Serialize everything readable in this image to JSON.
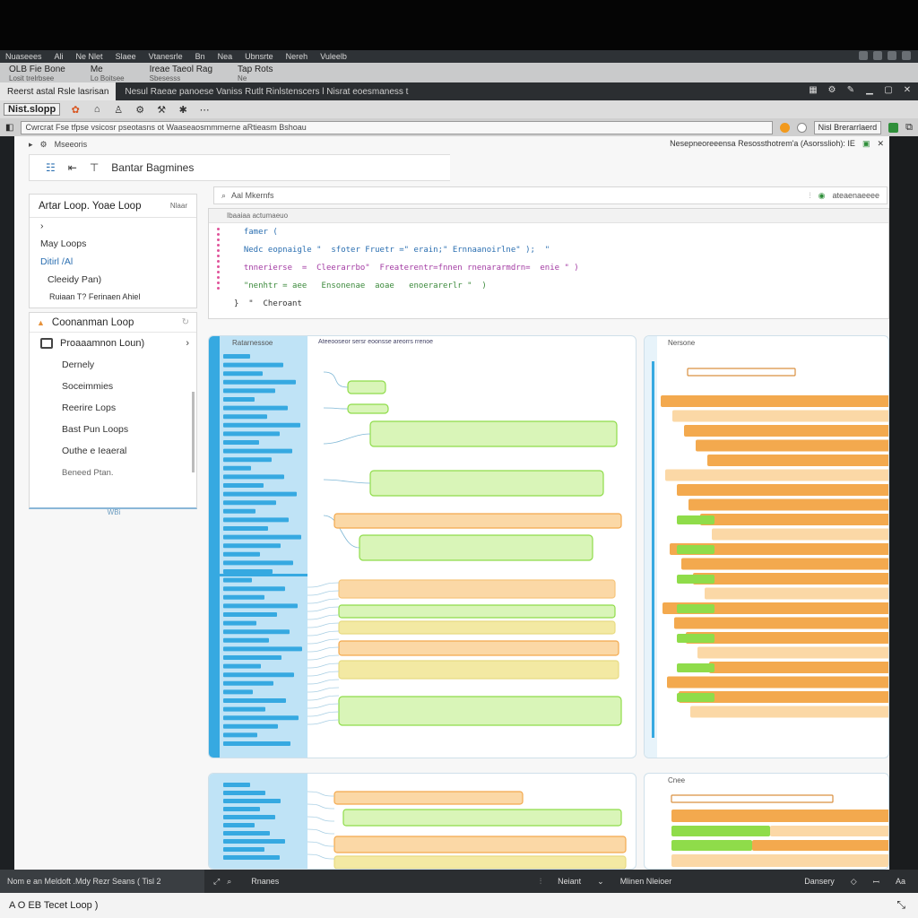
{
  "menubar": {
    "items": [
      "Nuaseees",
      "Ali",
      "Ne Nlet",
      "Slaee",
      "Vtanesrle",
      "Bn",
      "Nea",
      "Ubnsrte",
      "Nereh",
      "Vuleelb"
    ]
  },
  "menurow": {
    "items": [
      {
        "label": "OLB Fie Bone",
        "sub": "Losit trelrbsee"
      },
      {
        "label": "Me",
        "sub": "Lo Boitsee"
      },
      {
        "label": "Ireae Taeol Rag",
        "sub": "Sbesesss"
      },
      {
        "label": "Tap Rots",
        "sub": "Ne"
      }
    ]
  },
  "titlebar": {
    "tab": "Reerst astal Rsle lasrisan",
    "rest": "Nesul Raeae panoese Vaniss Rutlt Rinlstenscers l Nisrat eoesmaness t"
  },
  "toolbar": {
    "brand": "Nist.slopp"
  },
  "addrbar": {
    "url": "Cwrcrat Fse tfpse vsicosr  pseotasns ot Waaseaosmmmerne aRtieasm  Bshoau",
    "chip": "Nisl Brerarrlaerd"
  },
  "pathrow": {
    "left": "Mseeoris",
    "right": "Nesepneoreeensa Resossthotrem'a (Asorsslioh): IE"
  },
  "titlecard": {
    "label": "Bantar Bagmines"
  },
  "sidebar1": {
    "title": "Artar Loop. Yoae Loop",
    "badge": "Nlaar",
    "lines": [
      "›",
      "May Loops",
      "Ditirl /Al",
      "Cleeidy Pan)",
      "Ruiaan T? Ferinaen Ahiel"
    ]
  },
  "sidebar2": {
    "title": "Coonanman Loop",
    "folder": "Proaaamnon Loun)",
    "items": [
      "Dernely",
      "Soceimmies",
      "Reerire Lops",
      "Bast Pun Loops",
      "Outhe e Ieaeral",
      "Beneed Ptan."
    ],
    "footer": "WBi"
  },
  "search": {
    "placeholder": "Aal Mkernfs",
    "right": "ateaenaeeee"
  },
  "codecard": {
    "caption": "Ibaaiaa actumaeuo",
    "lines": [
      "  famer (",
      "  Nedc eopnaigle \"  sfoter Fruetr =\" erain;\" Ernnaanoirlne\" );  \"",
      "  tnnerierse  =  Cleerarrbo\"  Freaterentr=fnnen rnenararmdrn=  enie \" )",
      "  \"nenhtr = aee   Ensonenae  aoae   enoerarerlr \"  )",
      "}  \"  Cheroant"
    ]
  },
  "panels": {
    "a_title": "Ratarnessoe",
    "b_title": "Nersone",
    "c_title": "",
    "d_title": "Cnee",
    "a_header": "Ateeooseor sersr eoonsse  areorrs rrenoe"
  },
  "statusbar": {
    "msg": "Nom e an Meldoft .Mdy Rezr Seans  ( Tisl 2",
    "search": "Rnanes",
    "items": [
      "Neiant",
      "Mlinen Nleioer",
      "Dansery",
      "Aa"
    ]
  },
  "taskbar": {
    "label": "A  O  EB Tecet  Loop  )"
  },
  "colors": {
    "blue": "#36a9e1",
    "lightblue": "#bfe3f6",
    "green": "#8fdc4a",
    "lightgreen": "#d9f5b8",
    "orange": "#f3a94e",
    "lightorange": "#fbd8a6",
    "yellow": "#f3e9a3"
  }
}
